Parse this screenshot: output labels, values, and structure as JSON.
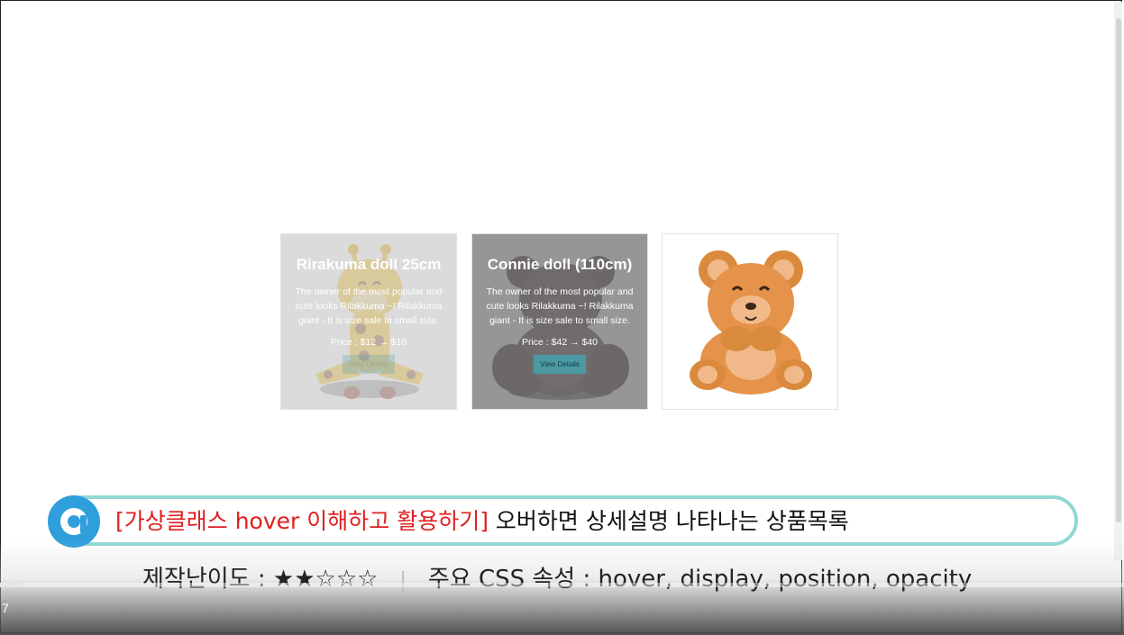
{
  "products": [
    {
      "title": "Rirakuma doll 25cm",
      "description": "The owner of the most popular and cute looks Rilakkuma ~! Rilakkuma giant - It is size sale to small size.",
      "price": "Price : $12 → $10",
      "button": "View Details",
      "image": "giraffe-plush",
      "state": "hover-fading"
    },
    {
      "title": "Connie doll (110cm)",
      "description": "The owner of the most popular and cute looks Rilakkuma ~! Rilakkuma giant - It is size sale to small size.",
      "price": "Price : $42 → $40",
      "button": "View Details",
      "image": "dark-bear-plush",
      "state": "hover"
    },
    {
      "image": "teddy-bear-plush",
      "state": "normal"
    }
  ],
  "caption": {
    "highlight": "[가상클래스 hover 이해하고 활용하기]",
    "rest": " 오버하면 상세설명 나타나는 상품목록",
    "logo_icon": "a-logo-icon"
  },
  "subline": {
    "difficulty": "제작난이도 : ★★☆☆☆",
    "separator": "|",
    "properties": "주요 CSS 속성 : hover, display, position, opacity"
  },
  "player": {
    "timecode": "7",
    "progress": 0.02
  },
  "colors": {
    "pill_border": "#92d8d3",
    "highlight": "#e01f1f",
    "button": "#4b9aa3",
    "logo": "#2f9fdc"
  }
}
